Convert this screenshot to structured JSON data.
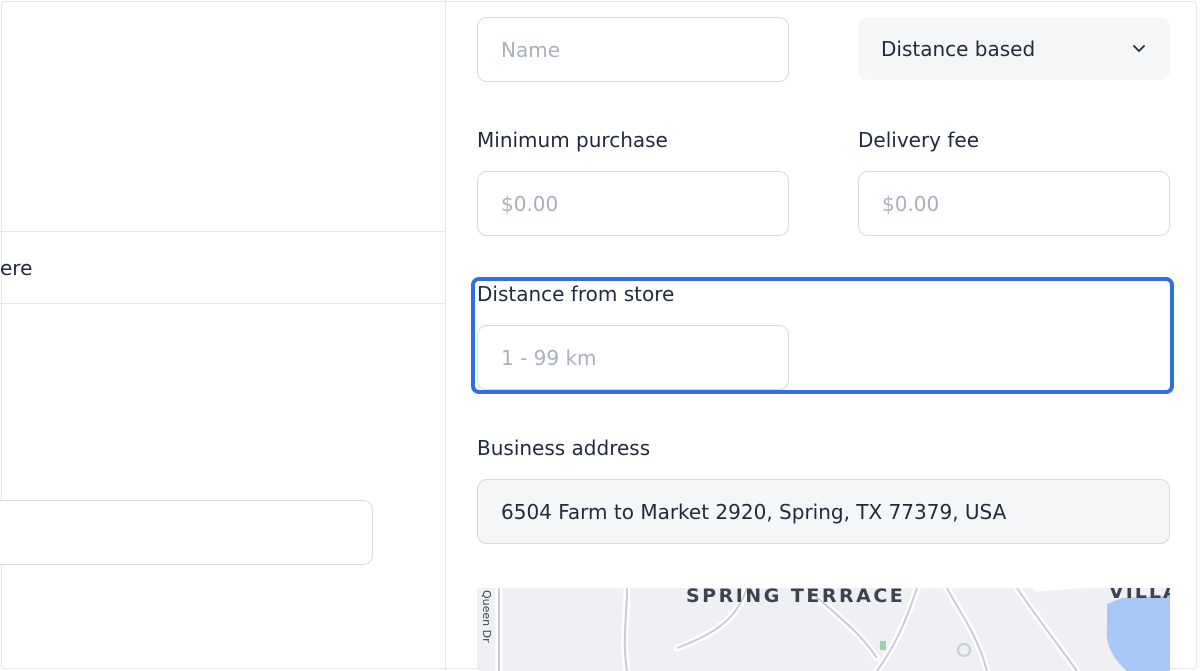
{
  "left": {
    "row_text": "ere"
  },
  "form": {
    "name_placeholder": "Name",
    "type_select_value": "Distance based",
    "min_purchase_label": "Minimum purchase",
    "min_purchase_placeholder": "$0.00",
    "delivery_fee_label": "Delivery fee",
    "delivery_fee_placeholder": "$0.00",
    "distance_label": "Distance from store",
    "distance_placeholder": "1 - 99 km",
    "address_label": "Business address",
    "address_value": "6504 Farm to Market 2920, Spring, TX 77379, USA"
  },
  "map": {
    "area_label": "SPRING TERRACE",
    "corner_label": "VILLA",
    "street_label": "Queen Dr"
  },
  "colors": {
    "highlight": "#2f6fe0",
    "border": "#d6dbe1",
    "map_water": "#a7c7f5"
  }
}
